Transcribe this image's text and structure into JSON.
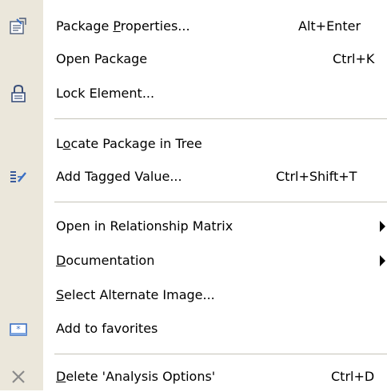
{
  "menu": {
    "items": [
      {
        "label": "Package Properties...",
        "mnemonic": "P",
        "mnemonic_index": 8,
        "shortcut": "Alt+Enter",
        "icon": "properties-icon"
      },
      {
        "label": "Open Package",
        "shortcut": "Ctrl+K",
        "icon": ""
      },
      {
        "label": "Lock Element...",
        "shortcut": "",
        "icon": "lock-icon"
      },
      {
        "label": "Locate Package in Tree",
        "mnemonic": "o",
        "mnemonic_index": 1,
        "shortcut": "",
        "icon": ""
      },
      {
        "label": "Add Tagged Value...",
        "shortcut": "Ctrl+Shift+T",
        "icon": "tagged-value-icon"
      },
      {
        "label": "Open in Relationship Matrix",
        "shortcut": "",
        "submenu": true,
        "icon": ""
      },
      {
        "label": "Documentation",
        "mnemonic": "D",
        "mnemonic_index": 0,
        "shortcut": "",
        "submenu": true,
        "icon": ""
      },
      {
        "label": "Select Alternate Image...",
        "mnemonic": "S",
        "mnemonic_index": 0,
        "shortcut": "",
        "icon": ""
      },
      {
        "label": "Add to favorites",
        "shortcut": "",
        "icon": "favorites-icon"
      },
      {
        "label": "Delete 'Analysis Options'",
        "mnemonic": "D",
        "mnemonic_index": 0,
        "shortcut": "Ctrl+D",
        "icon": "delete-icon"
      }
    ]
  },
  "colors": {
    "gutter": "#ebe7db",
    "separator": "#c5c2b8",
    "text": "#000000"
  }
}
